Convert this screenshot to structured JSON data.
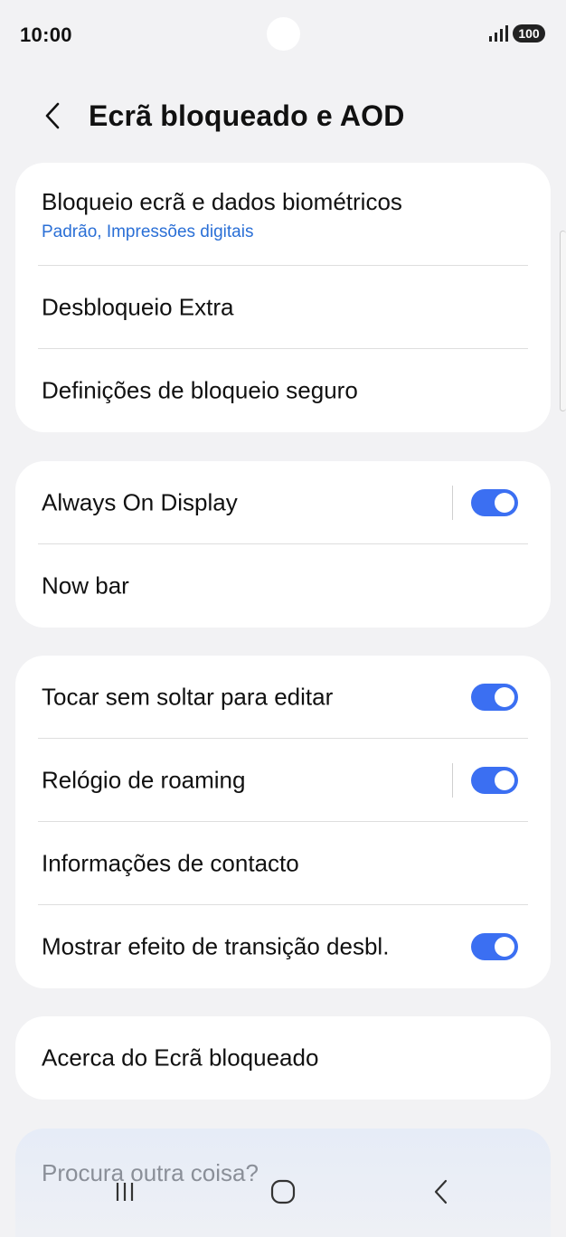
{
  "status": {
    "time": "10:00",
    "battery": "100"
  },
  "header": {
    "title": "Ecrã bloqueado e AOD"
  },
  "group1": {
    "items": [
      {
        "label": "Bloqueio ecrã e dados biométricos",
        "sub": "Padrão, Impressões digitais"
      },
      {
        "label": "Desbloqueio Extra"
      },
      {
        "label": "Definições de bloqueio seguro"
      }
    ]
  },
  "group2": {
    "items": [
      {
        "label": "Always On Display",
        "toggle": true
      },
      {
        "label": "Now bar"
      }
    ]
  },
  "group3": {
    "items": [
      {
        "label": "Tocar sem soltar para editar",
        "toggle": true
      },
      {
        "label": "Relógio de roaming",
        "toggle": true
      },
      {
        "label": "Informações de contacto"
      },
      {
        "label": "Mostrar efeito de transição desbl.",
        "toggle": true
      }
    ]
  },
  "group4": {
    "items": [
      {
        "label": "Acerca do Ecrã bloqueado"
      }
    ]
  },
  "footer": {
    "text": "Procura outra coisa?"
  },
  "colors": {
    "accent": "#3b6ff2",
    "link": "#2a6fd6",
    "background": "#f2f2f4"
  }
}
